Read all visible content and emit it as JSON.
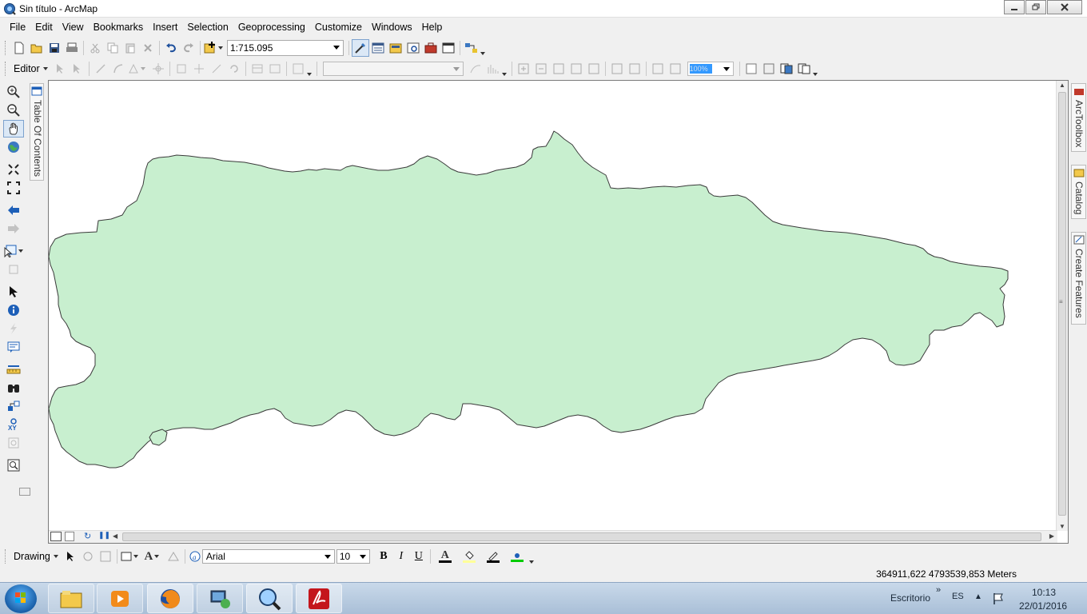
{
  "window": {
    "title": "Sin título - ArcMap",
    "controls": [
      "minimize",
      "maximize",
      "close"
    ]
  },
  "menu": [
    "File",
    "Edit",
    "View",
    "Bookmarks",
    "Insert",
    "Selection",
    "Geoprocessing",
    "Customize",
    "Windows",
    "Help"
  ],
  "standard_toolbar": {
    "scale": "1:715.095",
    "icons": [
      "new-document-icon",
      "open-icon",
      "save-icon",
      "print-icon",
      "cut-icon",
      "copy-icon",
      "paste-icon",
      "delete-icon",
      "undo-icon",
      "redo-icon",
      "add-data-icon",
      "editor-toolbar-icon",
      "table-of-contents-icon",
      "catalog-window-icon",
      "search-window-icon",
      "arctoolbox-icon",
      "python-window-icon",
      "model-builder-icon"
    ]
  },
  "editor_toolbar": {
    "label": "Editor",
    "combo_value": "",
    "zoom_percent": "100%"
  },
  "left_tools": [
    "zoom-in-icon",
    "zoom-out-icon",
    "pan-icon",
    "full-extent-icon",
    "fixed-zoom-in-icon",
    "fixed-zoom-out-icon",
    "go-back-icon",
    "go-forward-icon",
    "select-features-icon",
    "clear-selection-icon",
    "select-elements-icon",
    "identify-icon",
    "hyperlink-icon",
    "html-popup-icon",
    "measure-icon",
    "find-icon",
    "find-route-icon",
    "go-to-xy-icon",
    "time-slider-icon",
    "magnifier-icon"
  ],
  "toc_tab_label": "Table Of Contents",
  "right_tabs": [
    "ArcToolbox",
    "Catalog",
    "Create Features"
  ],
  "drawing_toolbar": {
    "label": "Drawing",
    "font": "Arial",
    "size": "10",
    "bold": "B",
    "italic": "I",
    "underline": "U",
    "font_color_glyph": "A",
    "colors": {
      "font": "#000000",
      "fill": "#ffff99",
      "line": "#000000",
      "marker": "#00cc00"
    }
  },
  "status": {
    "coordinates": "364911,622  4793539,853 Meters"
  },
  "map": {
    "polygon_fill": "#c8efcf",
    "polygon_stroke": "#3a3a3a"
  },
  "taskbar": {
    "apps": [
      "explorer-icon",
      "media-player-icon",
      "firefox-icon",
      "network-icon",
      "search-icon",
      "pdf-icon"
    ],
    "desktop_label": "Escritorio",
    "language": "ES",
    "time": "10:13",
    "date": "22/01/2016"
  }
}
